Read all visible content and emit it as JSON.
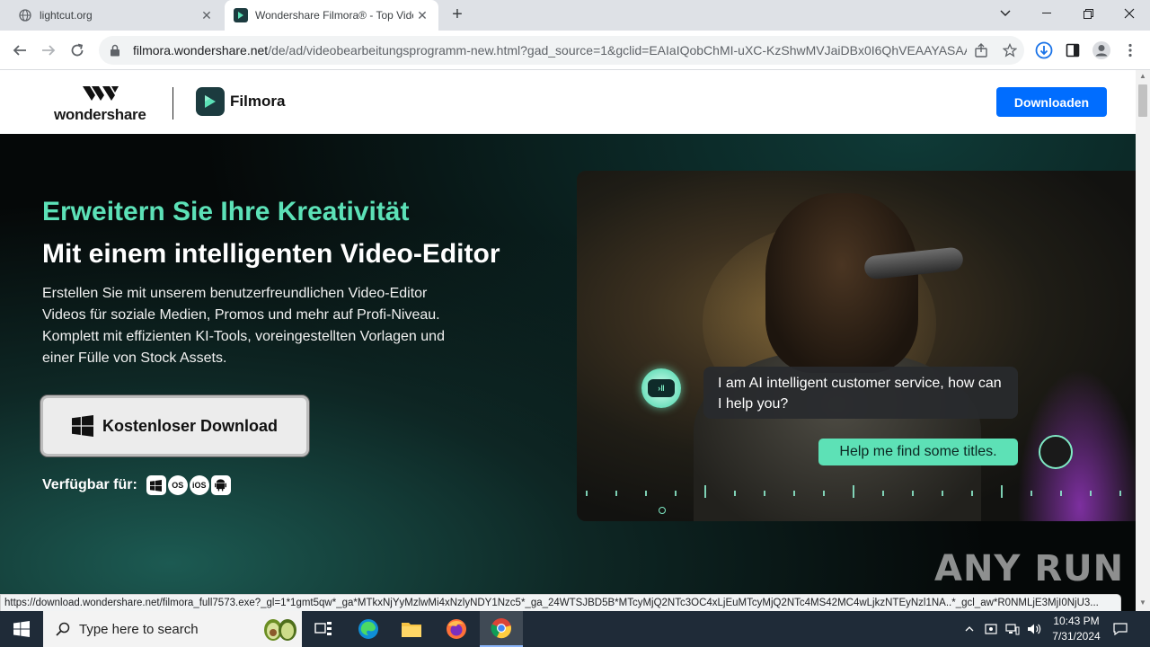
{
  "browser": {
    "tabs": [
      {
        "title": "lightcut.org",
        "active": false
      },
      {
        "title": "Wondershare Filmora® - Top Video",
        "active": true
      }
    ],
    "new_tab": "+",
    "url_host": "filmora.wondershare.net",
    "url_path": "/de/ad/videobearbeitungsprogramm-new.html?gad_source=1&gclid=EAIaIQobChMI-uXC-KzShwMVJaiDBx0I6QhVEAAYASAA..."
  },
  "site": {
    "brand": "wondershare",
    "product": "Filmora",
    "header_download": "Downloaden"
  },
  "hero": {
    "eyebrow": "Erweitern Sie Ihre Kreativität",
    "title": "Mit einem intelligenten Video-Editor",
    "description": "Erstellen Sie mit unserem benutzerfreundlichen Video-Editor Videos für soziale Medien, Promos und mehr auf Profi-Niveau. Komplett mit effizienten KI-Tools, voreingestellten Vorlagen und einer Fülle von Stock Assets.",
    "cta_label": "Kostenloser Download",
    "available_label": "Verfügbar für:",
    "platforms": [
      "windows-icon",
      "macos-icon",
      "ios-icon",
      "android-icon"
    ],
    "platform_texts": {
      "macos": "OS",
      "ios": "iOS"
    }
  },
  "video": {
    "ai_message": "I am AI intelligent customer service, how can I help you?",
    "user_message": "Help me find some titles."
  },
  "status_url": "https://download.wondershare.net/filmora_full7573.exe?_gl=1*1gmt5qw*_ga*MTkxNjYyMzlwMi4xNzlyNDY1Nzc5*_ga_24WTSJBD5B*MTcyMjQ2NTc3OC4xLjEuMTcyMjQ2NTc4MS42MC4wLjkzNTEyNzl1NA..*_gcl_aw*R0NMLjE3MjI0NjU3...",
  "watermark": "ANY RUN",
  "taskbar": {
    "search_placeholder": "Type here to search",
    "time": "10:43 PM",
    "date": "7/31/2024"
  },
  "colors": {
    "accent_green": "#5ce1b7",
    "download_blue": "#006dff"
  }
}
